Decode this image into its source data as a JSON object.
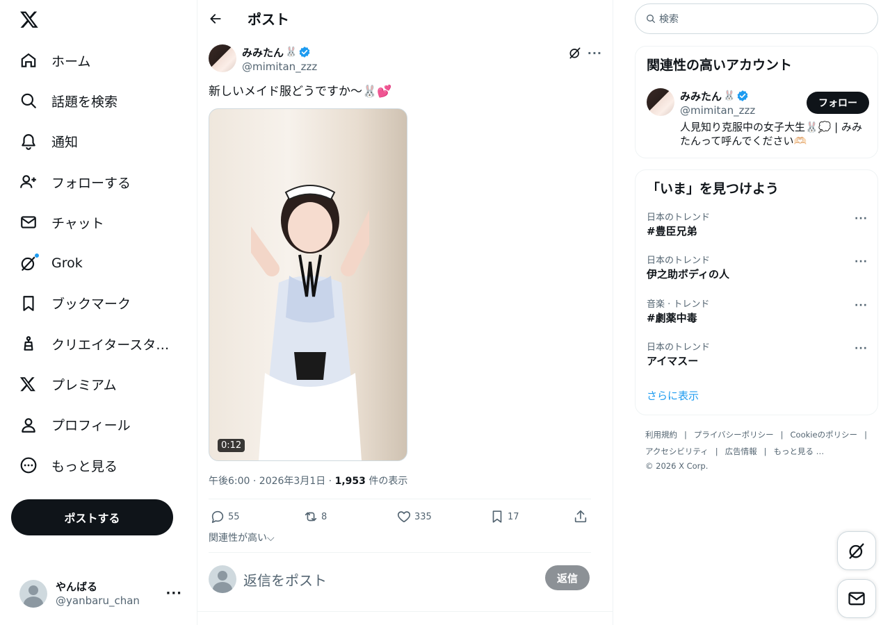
{
  "nav": {
    "items": [
      {
        "label": "ホーム"
      },
      {
        "label": "話題を検索"
      },
      {
        "label": "通知"
      },
      {
        "label": "フォローする"
      },
      {
        "label": "チャット"
      },
      {
        "label": "Grok"
      },
      {
        "label": "ブックマーク"
      },
      {
        "label": "クリエイタースタ…"
      },
      {
        "label": "プレミアム"
      },
      {
        "label": "プロフィール"
      },
      {
        "label": "もっと見る"
      }
    ],
    "post_button": "ポストする",
    "account": {
      "name": "やんばる",
      "handle": "@yanbaru_chan"
    }
  },
  "main": {
    "title": "ポスト",
    "tweet": {
      "author_name": "みみたん",
      "author_emoji": "🐰",
      "author_handle": "@mimitan_zzz",
      "text": "新しいメイド服どうですか〜🐰💕",
      "video_duration": "0:12",
      "time": "午後6:00 · 2026年3月1日 · ",
      "views": "1,953",
      "views_suffix": " 件の表示",
      "replies": "55",
      "reposts": "8",
      "likes": "335",
      "bookmarks": "17"
    },
    "relevance_label": "関連性が高い⌵",
    "reply_placeholder": "返信をポスト",
    "reply_button": "返信"
  },
  "right": {
    "search_placeholder": "検索",
    "related": {
      "title": "関連性の高いアカウント",
      "name": "みみたん",
      "emoji": "🐰",
      "handle": "@mimitan_zzz",
      "bio": "人見知り克服中の女子大生🐰💭 | みみたんって呼んでください🫶🏻",
      "follow_button": "フォロー"
    },
    "trends": {
      "title": "「いま」を見つけよう",
      "items": [
        {
          "category": "日本のトレンド",
          "name": "#豊臣兄弟"
        },
        {
          "category": "日本のトレンド",
          "name": "伊之助ボディの人"
        },
        {
          "category": "音楽 · トレンド",
          "name": "#劇薬中毒"
        },
        {
          "category": "日本のトレンド",
          "name": "アイマスー"
        }
      ],
      "show_more": "さらに表示"
    },
    "footer": {
      "links": [
        "利用規約",
        "プライバシーポリシー",
        "Cookieのポリシー",
        "アクセシビリティ",
        "広告情報",
        "もっと見る …"
      ],
      "copyright": "© 2026 X Corp."
    }
  }
}
